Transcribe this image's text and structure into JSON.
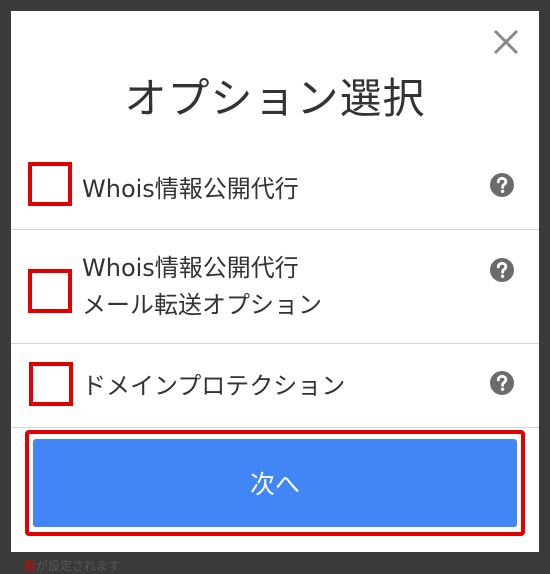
{
  "modal": {
    "title": "オプション選択",
    "close_icon": "close-icon"
  },
  "options": [
    {
      "label": "Whois情報公開代行",
      "checked": false,
      "help_icon": "question-circle-icon"
    },
    {
      "label_line1": "Whois情報公開代行",
      "label_line2": "メール転送オプション",
      "checked": false,
      "help_icon": "question-circle-icon"
    },
    {
      "label": "ドメインプロテクション",
      "checked": false,
      "help_icon": "question-circle-icon"
    }
  ],
  "next_button": {
    "label": "次へ"
  },
  "background_text": {
    "prefix": "新",
    "rest": "が設定されます"
  },
  "colors": {
    "accent_red": "#e10000",
    "button_blue": "#4285f4",
    "text": "#333333",
    "icon_gray": "#6b6b6b"
  }
}
